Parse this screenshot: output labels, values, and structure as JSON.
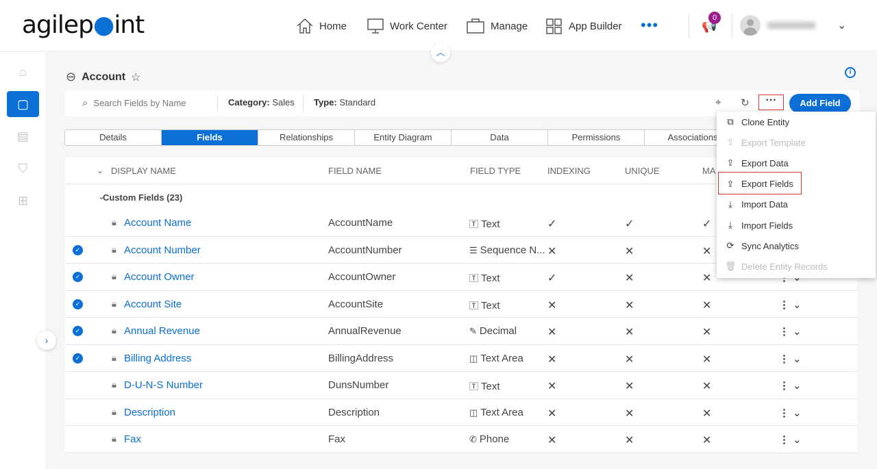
{
  "brand": {
    "logo": "agilepoint"
  },
  "nav": {
    "home": "Home",
    "work_center": "Work Center",
    "manage": "Manage",
    "app_builder": "App Builder",
    "notifications": "0"
  },
  "page": {
    "title": "Account",
    "search_placeholder": "Search Fields by Name",
    "category_label": "Category:",
    "category_value": "Sales",
    "type_label": "Type:",
    "type_value": "Standard",
    "add_field": "Add Field"
  },
  "tabs": [
    "Details",
    "Fields",
    "Relationships",
    "Entity Diagram",
    "Data",
    "Permissions",
    "Associations"
  ],
  "columns": {
    "display_name": "DISPLAY NAME",
    "field_name": "FIELD NAME",
    "field_type": "FIELD TYPE",
    "indexing": "INDEXING",
    "unique": "UNIQUE",
    "mandatory": "MA"
  },
  "group": "Custom Fields (23)",
  "rows": [
    {
      "display": "Account Name",
      "field": "AccountName",
      "type": "Text",
      "type_icon": "text-icon",
      "selected": false,
      "indexing": "✓",
      "unique": "✓",
      "mandatory": "✓"
    },
    {
      "display": "Account Number",
      "field": "AccountNumber",
      "type": "Sequence N...",
      "type_icon": "list-icon",
      "selected": true,
      "indexing": "✕",
      "unique": "✕",
      "mandatory": "✕"
    },
    {
      "display": "Account Owner",
      "field": "AccountOwner",
      "type": "Text",
      "type_icon": "text-icon",
      "selected": true,
      "indexing": "✓",
      "unique": "✕",
      "mandatory": "✕"
    },
    {
      "display": "Account Site",
      "field": "AccountSite",
      "type": "Text",
      "type_icon": "text-icon",
      "selected": true,
      "indexing": "✕",
      "unique": "✕",
      "mandatory": "✕"
    },
    {
      "display": "Annual Revenue",
      "field": "AnnualRevenue",
      "type": "Decimal",
      "type_icon": "decimal-icon",
      "selected": true,
      "indexing": "✕",
      "unique": "✕",
      "mandatory": "✕"
    },
    {
      "display": "Billing Address",
      "field": "BillingAddress",
      "type": "Text Area",
      "type_icon": "text-area-icon",
      "selected": true,
      "indexing": "✕",
      "unique": "✕",
      "mandatory": "✕"
    },
    {
      "display": "D-U-N-S Number",
      "field": "DunsNumber",
      "type": "Text",
      "type_icon": "text-icon",
      "selected": false,
      "indexing": "✕",
      "unique": "✕",
      "mandatory": "✕"
    },
    {
      "display": "Description",
      "field": "Description",
      "type": "Text Area",
      "type_icon": "text-area-icon",
      "selected": false,
      "indexing": "✕",
      "unique": "✕",
      "mandatory": "✕"
    },
    {
      "display": "Fax",
      "field": "Fax",
      "type": "Phone",
      "type_icon": "phone-icon",
      "selected": false,
      "indexing": "✕",
      "unique": "✕",
      "mandatory": "✕"
    }
  ],
  "menu": [
    {
      "label": "Clone Entity",
      "enabled": true
    },
    {
      "label": "Export Template",
      "enabled": false
    },
    {
      "label": "Export Data",
      "enabled": true
    },
    {
      "label": "Export Fields",
      "enabled": true,
      "highlighted": true
    },
    {
      "label": "Import Data",
      "enabled": true
    },
    {
      "label": "Import Fields",
      "enabled": true
    },
    {
      "label": "Sync Analytics",
      "enabled": true
    },
    {
      "label": "Delete Entity Records",
      "enabled": false
    }
  ],
  "colors": {
    "accent": "#0b6fd6",
    "highlight": "#dd3333",
    "badge": "#9b1c8a"
  }
}
